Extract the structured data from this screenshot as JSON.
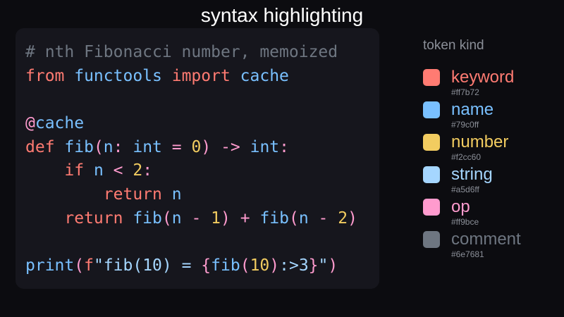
{
  "title": "syntax highlighting",
  "colors": {
    "keyword": "#ff7b72",
    "name": "#79c0ff",
    "number": "#f2cc60",
    "string": "#a5d6ff",
    "op": "#ff9bce",
    "comment": "#6e7681"
  },
  "code_lines": [
    [
      [
        "comment",
        "# nth Fibonacci number, memoized"
      ]
    ],
    [
      [
        "keyword",
        "from"
      ],
      [
        "name",
        " functools "
      ],
      [
        "keyword",
        "import"
      ],
      [
        "name",
        " cache"
      ]
    ],
    [],
    [
      [
        "op",
        "@"
      ],
      [
        "name",
        "cache"
      ]
    ],
    [
      [
        "keyword",
        "def"
      ],
      [
        "name",
        " fib"
      ],
      [
        "op",
        "("
      ],
      [
        "name",
        "n"
      ],
      [
        "op",
        ":"
      ],
      [
        "name",
        " int "
      ],
      [
        "op",
        "="
      ],
      [
        "name",
        " "
      ],
      [
        "number",
        "0"
      ],
      [
        "op",
        ")"
      ],
      [
        "name",
        " "
      ],
      [
        "op",
        "->"
      ],
      [
        "name",
        " int"
      ],
      [
        "op",
        ":"
      ]
    ],
    [
      [
        "name",
        "    "
      ],
      [
        "keyword",
        "if"
      ],
      [
        "name",
        " n "
      ],
      [
        "op",
        "<"
      ],
      [
        "name",
        " "
      ],
      [
        "number",
        "2"
      ],
      [
        "op",
        ":"
      ]
    ],
    [
      [
        "name",
        "        "
      ],
      [
        "keyword",
        "return"
      ],
      [
        "name",
        " n"
      ]
    ],
    [
      [
        "name",
        "    "
      ],
      [
        "keyword",
        "return"
      ],
      [
        "name",
        " fib"
      ],
      [
        "op",
        "("
      ],
      [
        "name",
        "n "
      ],
      [
        "op",
        "-"
      ],
      [
        "name",
        " "
      ],
      [
        "number",
        "1"
      ],
      [
        "op",
        ")"
      ],
      [
        "name",
        " "
      ],
      [
        "op",
        "+"
      ],
      [
        "name",
        " fib"
      ],
      [
        "op",
        "("
      ],
      [
        "name",
        "n "
      ],
      [
        "op",
        "-"
      ],
      [
        "name",
        " "
      ],
      [
        "number",
        "2"
      ],
      [
        "op",
        ")"
      ]
    ],
    [],
    [
      [
        "name",
        "print"
      ],
      [
        "op",
        "("
      ],
      [
        "keyword",
        "f"
      ],
      [
        "string",
        "\"fib(10) = "
      ],
      [
        "op",
        "{"
      ],
      [
        "name",
        "fib"
      ],
      [
        "op",
        "("
      ],
      [
        "number",
        "10"
      ],
      [
        "op",
        ")"
      ],
      [
        "string",
        ":>3"
      ],
      [
        "op",
        "}"
      ],
      [
        "string",
        "\""
      ],
      [
        "op",
        ")"
      ]
    ]
  ],
  "legend": {
    "title": "token kind",
    "items": [
      {
        "label": "keyword",
        "hex": "#ff7b72"
      },
      {
        "label": "name",
        "hex": "#79c0ff"
      },
      {
        "label": "number",
        "hex": "#f2cc60"
      },
      {
        "label": "string",
        "hex": "#a5d6ff"
      },
      {
        "label": "op",
        "hex": "#ff9bce"
      },
      {
        "label": "comment",
        "hex": "#6e7681"
      }
    ]
  }
}
